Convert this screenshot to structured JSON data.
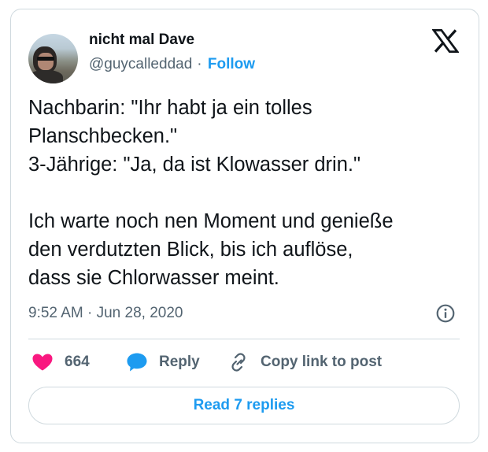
{
  "author": {
    "display_name": "nicht mal Dave",
    "handle": "@guycalleddad",
    "separator": "·",
    "follow_label": "Follow"
  },
  "tweet": {
    "text": "Nachbarin: \"Ihr habt ja ein tolles\nPlanschbecken.\"\n3-Jährige: \"Ja, da ist Klowasser drin.\"\n\nIch warte noch nen Moment und genieße\nden verdutzten Blick, bis ich auflöse,\ndass sie Chlorwasser meint.",
    "timestamp": "9:52 AM · Jun 28, 2020"
  },
  "actions": {
    "like_count": "664",
    "reply_label": "Reply",
    "copy_link_label": "Copy link to post"
  },
  "read_replies_label": "Read 7 replies",
  "icons": {
    "brand": "x-logo-icon",
    "info": "info-icon",
    "like": "heart-icon",
    "reply": "speech-bubble-icon",
    "copy": "link-icon"
  },
  "colors": {
    "text": "#0f1419",
    "secondary": "#536471",
    "accent": "#1d9bf0",
    "like": "#f91880",
    "border": "#cfd9de"
  }
}
